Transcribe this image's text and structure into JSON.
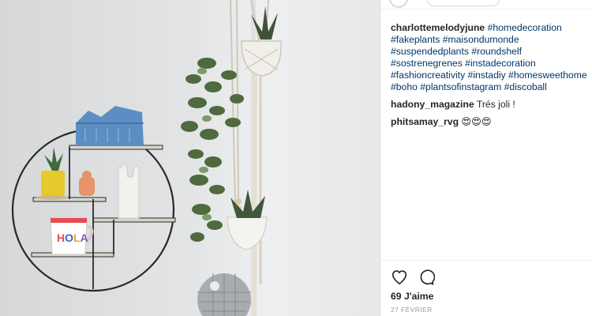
{
  "post": {
    "photo_text": "HOLA",
    "caption": {
      "username": "charlottemelodyjune",
      "hashtags": "#homedecoration #fakeplants #maisondumonde #suspendedplants #roundshelf #sostrenegrenes #instadecoration #fashioncreativity #instadiy #homesweethome #boho #plantsofinstagram #discoball"
    },
    "comments": [
      {
        "username": "hadony_magazine",
        "text": "Trés joli !"
      },
      {
        "username": "phitsamay_rvg",
        "text": "😍😍😍"
      }
    ],
    "actions": {
      "like_icon": "heart-icon",
      "comment_icon": "comment-icon"
    },
    "likes": "69 J'aime",
    "date": "27 FÉVRIER"
  }
}
